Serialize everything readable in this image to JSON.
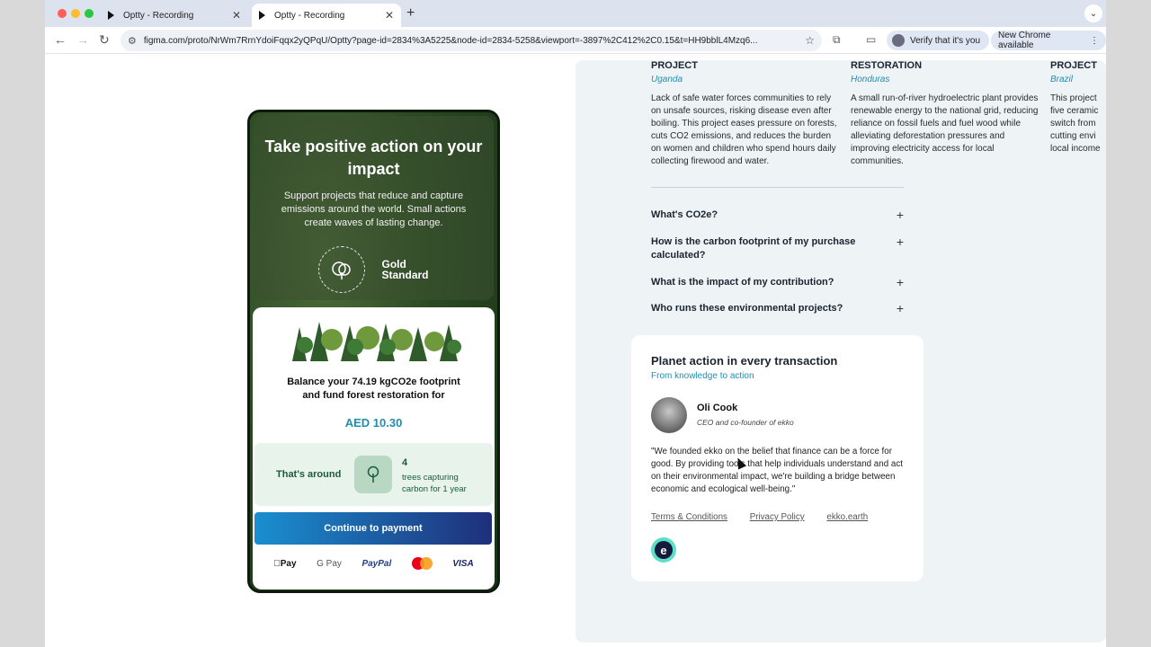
{
  "tabs": [
    {
      "label": "Optty - Recording",
      "active": false
    },
    {
      "label": "Optty - Recording",
      "active": true
    }
  ],
  "toolbar": {
    "url": "figma.com/proto/NrWm7RrnYdoiFqqx2yQPqU/Optty?page-id=2834%3A5225&node-id=2834-5258&viewport=-3897%2C412%2C0.15&t=HH9bblL4Mzq6...",
    "verify_label": "Verify that it's you",
    "update_label": "New Chrome available"
  },
  "phone": {
    "hero_title": "Take positive action on your impact",
    "hero_text": "Support projects that reduce and capture emissions around the world. Small actions create waves of lasting change.",
    "logo_left": "PRICELESS PLANET COALITION",
    "logo_right_1": "Gold",
    "logo_right_2": "Standard",
    "balance_text": "Balance your 74.19 kgCO2e footprint and fund forest restoration for",
    "price": "AED 10.30",
    "around_label": "That's around",
    "trees_count": "4",
    "trees_desc": "trees capturing carbon for 1 year",
    "pay_button": "Continue to payment",
    "payment_methods": [
      "Pay",
      "G Pay",
      "PayPal",
      "",
      "VISA"
    ]
  },
  "projects": [
    {
      "heading": "PROJECT",
      "location": "Uganda",
      "text": "Lack of safe water forces communities to rely on unsafe sources, risking disease even after boiling. This project eases pressure on forests, cuts CO2 emissions, and reduces the burden on women and children who spend hours daily collecting firewood and water."
    },
    {
      "heading": "RESTORATION",
      "location": "Honduras",
      "text": "A small run-of-river hydroelectric plant provides renewable energy to the national grid, reducing reliance on fossil fuels and fuel wood while alleviating deforestation pressures and improving electricity access for local communities."
    },
    {
      "heading": "PROJECT",
      "location": "Brazil",
      "text": "This project five ceramic switch from cutting envi local income"
    }
  ],
  "faqs": [
    "What's CO2e?",
    "How is the carbon footprint of my purchase calculated?",
    "What is the impact of my contribution?",
    "Who runs these environmental projects?"
  ],
  "planet": {
    "title": "Planet action in every transaction",
    "subtitle": "From knowledge to action",
    "person_name": "Oli Cook",
    "person_role": "CEO and co-founder of ekko",
    "quote": "\"We founded ekko on the belief that finance can be a force for good. By providing tools that help individuals understand and act on their environmental impact, we're building a bridge between economic and ecological well-being.\"",
    "links": [
      "Terms & Conditions",
      "Privacy Policy",
      "ekko.earth"
    ],
    "logo_letter": "e"
  },
  "colors": {
    "accent": "#1f8fb0",
    "green": "#1a5c3a",
    "button_start": "#1a8fd0",
    "button_end": "#1f2f7a"
  }
}
